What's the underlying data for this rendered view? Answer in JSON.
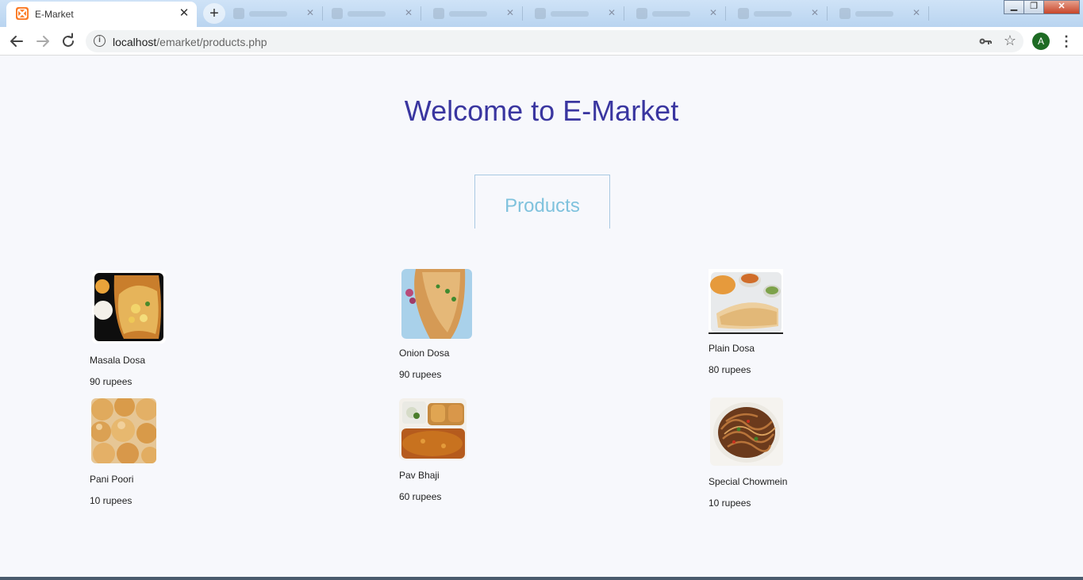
{
  "browser": {
    "tab_title": "E-Market",
    "url_host": "localhost",
    "url_path": "/emarket/products.php",
    "avatar_letter": "A",
    "favicon_color": "#fb7a24"
  },
  "page": {
    "heading": "Welcome to E-Market",
    "section_tab": "Products"
  },
  "products": [
    {
      "name": "Masala Dosa",
      "price": "90 rupees"
    },
    {
      "name": "Onion Dosa",
      "price": "90 rupees"
    },
    {
      "name": "Plain Dosa",
      "price": "80 rupees"
    },
    {
      "name": "Pani Poori",
      "price": "10 rupees"
    },
    {
      "name": "Pav Bhaji",
      "price": "60 rupees"
    },
    {
      "name": "Special Chowmein",
      "price": "10 rupees"
    }
  ],
  "colors": {
    "heading": "#3a36a0",
    "section_tab_text": "#7fc2dd",
    "page_background": "#f7f8fc"
  }
}
